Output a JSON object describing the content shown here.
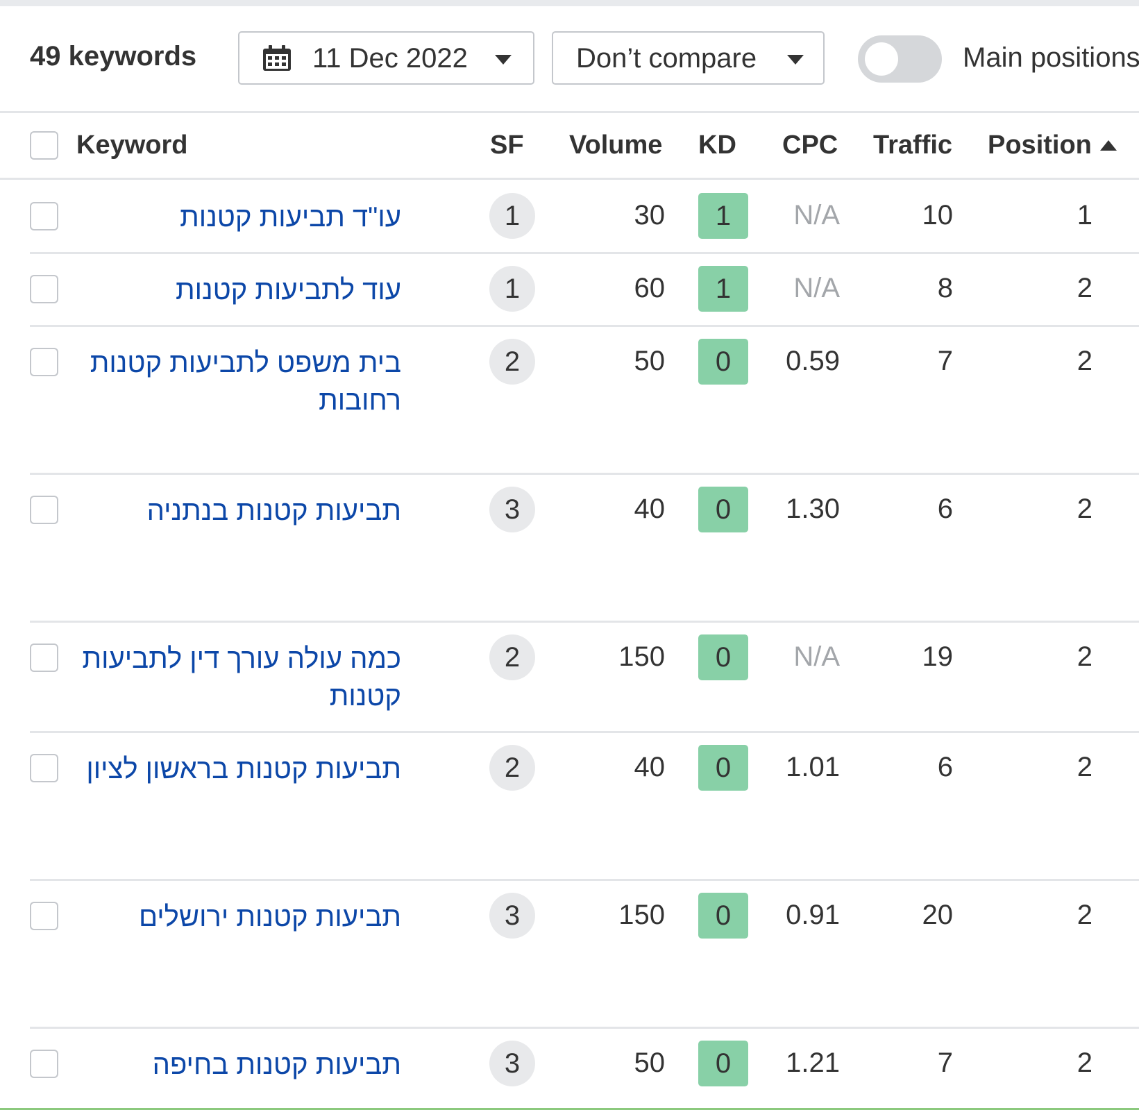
{
  "toolbar": {
    "keyword_count": "49 keywords",
    "date_value": "11 Dec 2022",
    "compare_value": "Don’t compare",
    "toggle_label": "Main positions",
    "toggle_on": false
  },
  "table": {
    "columns": {
      "keyword": "Keyword",
      "sf": "SF",
      "volume": "Volume",
      "kd": "KD",
      "cpc": "CPC",
      "traffic": "Traffic",
      "position": "Position"
    },
    "sort": {
      "column": "Position",
      "direction": "ascending"
    },
    "rows": [
      {
        "keyword": "עו\"ד תביעות קטנות",
        "sf": "1",
        "volume": "30",
        "kd": "1",
        "cpc": "N/A",
        "traffic": "10",
        "position": "1"
      },
      {
        "keyword": "עוד לתביעות קטנות",
        "sf": "1",
        "volume": "60",
        "kd": "1",
        "cpc": "N/A",
        "traffic": "8",
        "position": "2"
      },
      {
        "keyword": "בית משפט לתביעות קטנות רחובות",
        "sf": "2",
        "volume": "50",
        "kd": "0",
        "cpc": "0.59",
        "traffic": "7",
        "position": "2"
      },
      {
        "keyword": "תביעות קטנות בנתניה",
        "sf": "3",
        "volume": "40",
        "kd": "0",
        "cpc": "1.30",
        "traffic": "6",
        "position": "2"
      },
      {
        "keyword": "כמה עולה עורך דין לתביעות קטנות",
        "sf": "2",
        "volume": "150",
        "kd": "0",
        "cpc": "N/A",
        "traffic": "19",
        "position": "2"
      },
      {
        "keyword": "תביעות קטנות בראשון לציון",
        "sf": "2",
        "volume": "40",
        "kd": "0",
        "cpc": "1.01",
        "traffic": "6",
        "position": "2"
      },
      {
        "keyword": "תביעות קטנות ירושלים",
        "sf": "3",
        "volume": "150",
        "kd": "0",
        "cpc": "0.91",
        "traffic": "20",
        "position": "2"
      },
      {
        "keyword": "תביעות קטנות בחיפה",
        "sf": "3",
        "volume": "50",
        "kd": "0",
        "cpc": "1.21",
        "traffic": "7",
        "position": "2"
      }
    ]
  },
  "colors": {
    "link": "#0c47a8",
    "kd_easy": "#88d0a7",
    "na_text": "#a3a6aa",
    "bottom_accent": "#8bc97d"
  }
}
